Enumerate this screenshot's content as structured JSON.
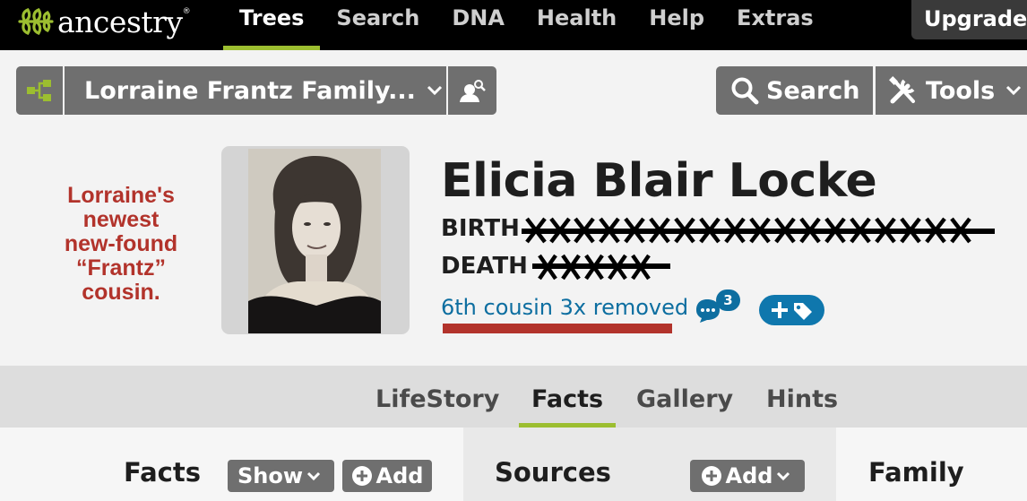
{
  "nav": {
    "logo_text": "ancestry",
    "logo_tm": "®",
    "links": [
      "Trees",
      "Search",
      "DNA",
      "Health",
      "Help",
      "Extras"
    ],
    "active": "Trees",
    "upgrade_label": "Upgrade"
  },
  "toolbar": {
    "tree_name": "Lorraine Frantz Family...",
    "search_label": "Search",
    "tools_label": "Tools",
    "icons": [
      "tree-icon",
      "chevron-down-icon",
      "person-search-icon",
      "search-icon",
      "tools-icon"
    ]
  },
  "annotation": {
    "lines": [
      "Lorraine's",
      "newest",
      "new-found",
      "“Frantz”",
      "cousin."
    ],
    "color": "#b2332b"
  },
  "profile": {
    "name": "Elicia Blair Locke",
    "birth_label": "BIRTH",
    "death_label": "DEATH",
    "relationship": "6th cousin 3x removed",
    "comment_count": "3",
    "accent_color": "#0d6ea0"
  },
  "tabs": {
    "items": [
      "LifeStory",
      "Facts",
      "Gallery",
      "Hints"
    ],
    "active": "Facts",
    "active_color": "#9cbe30"
  },
  "sections": {
    "facts_title": "Facts",
    "facts_show_label": "Show",
    "facts_add_label": "Add",
    "sources_title": "Sources",
    "sources_add_label": "Add",
    "family_title": "Family"
  }
}
